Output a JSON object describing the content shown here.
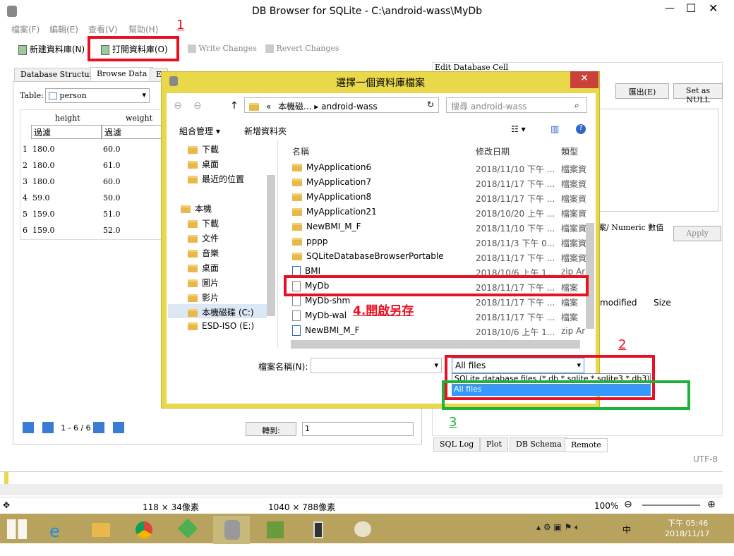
{
  "window": {
    "title": "DB Browser for SQLite - C:\\android-wass\\MyDb"
  },
  "menu": [
    "檔案(F)",
    "編輯(E)",
    "查看(V)",
    "幫助(H)"
  ],
  "toolbar": {
    "new_db": "新建資料庫(N)",
    "open_db": "打開資料庫(O)",
    "write": "Write Changes",
    "revert": "Revert Changes"
  },
  "tabs": {
    "structure": "Database Structure",
    "browse": "Browse Data",
    "e": "E"
  },
  "table": {
    "label": "Table:",
    "name": "person",
    "columns": [
      "height",
      "weight"
    ],
    "filter": "過濾",
    "rows": [
      {
        "n": "1",
        "h": "180.0",
        "w": "60.0"
      },
      {
        "n": "2",
        "h": "180.0",
        "w": "61.0"
      },
      {
        "n": "3",
        "h": "180.0",
        "w": "60.0"
      },
      {
        "n": "4",
        "h": "59.0",
        "w": "50.0"
      },
      {
        "n": "5",
        "h": "159.0",
        "w": "51.0"
      },
      {
        "n": "6",
        "h": "159.0",
        "w": "52.0"
      }
    ],
    "pager": "1 - 6 / 6",
    "goto": "轉到:",
    "goto_val": "1"
  },
  "edit_cell": {
    "title": "Edit Database Cell",
    "export": "匯出(E)",
    "null": "Set as NULL",
    "type": "案/ Numeric 數值",
    "apply": "Apply",
    "modified": "modified",
    "size": "Size"
  },
  "bottom_tabs": [
    "SQL Log",
    "Plot",
    "DB Schema",
    "Remote"
  ],
  "encoding": "UTF-8",
  "dialog": {
    "title": "選擇一個資料庫檔案",
    "crumb": [
      "«",
      "本機磁...",
      "android-wass"
    ],
    "search_placeholder": "搜尋 android-wass",
    "organize": "組合管理 ▾",
    "new_folder": "新增資料夾",
    "nav": [
      "下載",
      "桌面",
      "最近的位置",
      "本機",
      "下載",
      "文件",
      "音樂",
      "桌面",
      "圖片",
      "影片",
      "本機磁碟 (C:)",
      "ESD-ISO (E:)"
    ],
    "headers": {
      "name": "名稱",
      "date": "修改日期",
      "type": "類型"
    },
    "files": [
      {
        "name": "MyApplication6",
        "date": "2018/11/10 下午 ...",
        "type": "檔案資",
        "kind": "folder"
      },
      {
        "name": "MyApplication7",
        "date": "2018/11/17 下午 ...",
        "type": "檔案資",
        "kind": "folder"
      },
      {
        "name": "MyApplication8",
        "date": "2018/11/17 下午 ...",
        "type": "檔案資",
        "kind": "folder"
      },
      {
        "name": "MyApplication21",
        "date": "2018/10/20 上午 ...",
        "type": "檔案資",
        "kind": "folder"
      },
      {
        "name": "NewBMI_M_F",
        "date": "2018/11/10 下午 ...",
        "type": "檔案資",
        "kind": "folder"
      },
      {
        "name": "pppp",
        "date": "2018/11/3 下午 0...",
        "type": "檔案資",
        "kind": "folder"
      },
      {
        "name": "SQLiteDatabaseBrowserPortable",
        "date": "2018/11/17 下午 ...",
        "type": "檔案資",
        "kind": "folder"
      },
      {
        "name": "BMI",
        "date": "2018/10/6 上午 1...",
        "type": "zip Ar",
        "kind": "zip"
      },
      {
        "name": "MyDb",
        "date": "2018/11/17 下午 ...",
        "type": "檔案",
        "kind": "doc"
      },
      {
        "name": "MyDb-shm",
        "date": "2018/11/17 下午 ...",
        "type": "檔案",
        "kind": "doc"
      },
      {
        "name": "MyDb-wal",
        "date": "2018/11/17 下午 ...",
        "type": "檔案",
        "kind": "doc"
      },
      {
        "name": "NewBMI_M_F",
        "date": "2018/10/6 上午 1...",
        "type": "zip Ar",
        "kind": "zip"
      }
    ],
    "filename_label": "檔案名稱(N):",
    "filter_value": "All files",
    "filter_options": [
      "SQLite database files (*.db *.sqlite *.sqlite3 *.db3)",
      "All files"
    ]
  },
  "annotations": {
    "a1": "1",
    "a2": "2",
    "a3": "3",
    "a4": "4.開啟另存"
  },
  "statusbar": {
    "sel": "118 × 34像素",
    "img": "1040 × 788像素",
    "zoom": "100%"
  },
  "clock": {
    "time": "下午 05:46",
    "date": "2018/11/17",
    "ime": "中"
  },
  "colors": {
    "dialog_border": "#e9d94a",
    "select_blue": "#3399ff",
    "annotation_red": "#e81123",
    "annotation_green": "#1fb23a"
  }
}
